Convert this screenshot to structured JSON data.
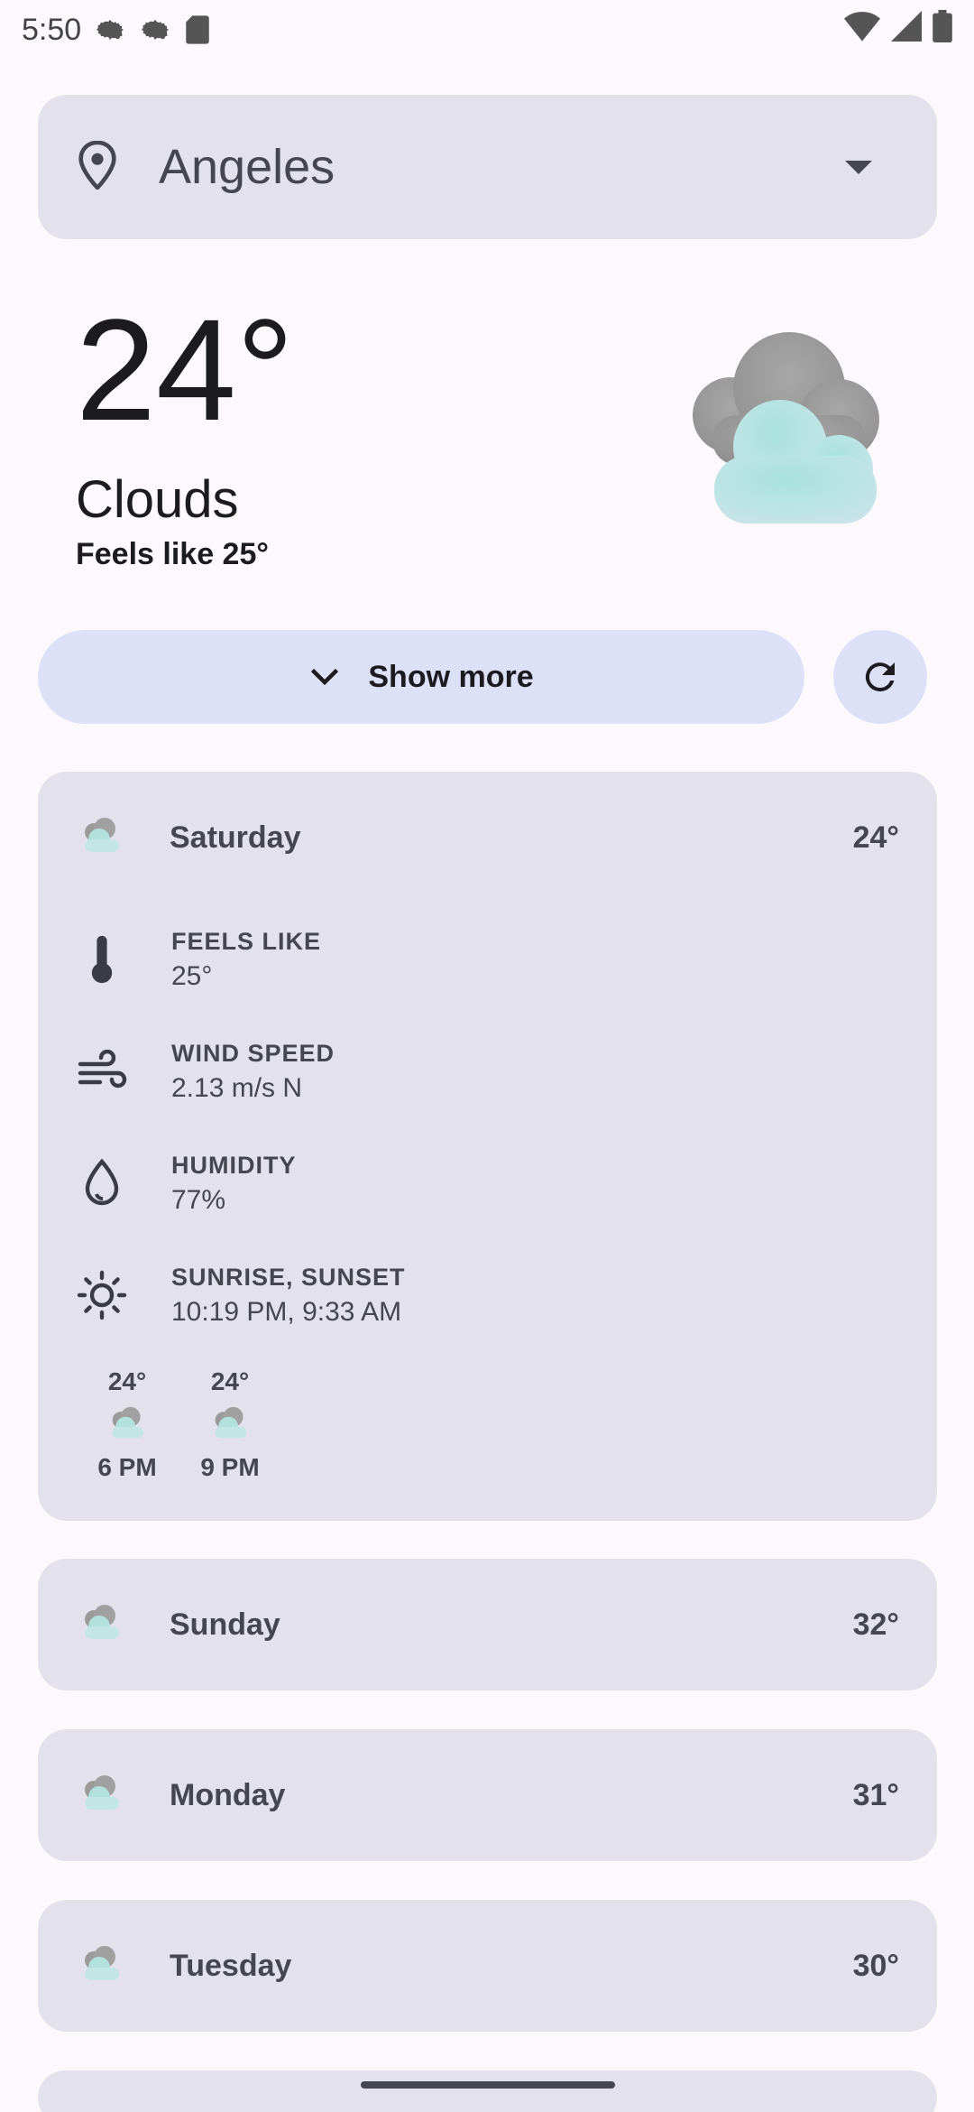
{
  "status_bar": {
    "time": "5:50"
  },
  "location": {
    "value": "Angeles"
  },
  "current": {
    "temperature": "24°",
    "condition": "Clouds",
    "feels_like": "Feels like 25°"
  },
  "actions": {
    "show_more": "Show more"
  },
  "today": {
    "day": "Saturday",
    "temp": "24°",
    "details": [
      {
        "label": "FEELS LIKE",
        "value": "25°",
        "icon": "thermometer-icon"
      },
      {
        "label": "WIND SPEED",
        "value": "2.13 m/s N",
        "icon": "wind-icon"
      },
      {
        "label": "HUMIDITY",
        "value": "77%",
        "icon": "humidity-icon"
      },
      {
        "label": "SUNRISE, SUNSET",
        "value": "10:19 PM, 9:33 AM",
        "icon": "sun-icon"
      }
    ],
    "hourly": [
      {
        "temp": "24°",
        "time": "6 PM",
        "icon": "cloud-icon"
      },
      {
        "temp": "24°",
        "time": "9 PM",
        "icon": "cloud-icon"
      }
    ]
  },
  "forecast": [
    {
      "day": "Sunday",
      "temp": "32°",
      "icon": "cloud-icon"
    },
    {
      "day": "Monday",
      "temp": "31°",
      "icon": "cloud-icon"
    },
    {
      "day": "Tuesday",
      "temp": "30°",
      "icon": "cloud-icon"
    }
  ]
}
